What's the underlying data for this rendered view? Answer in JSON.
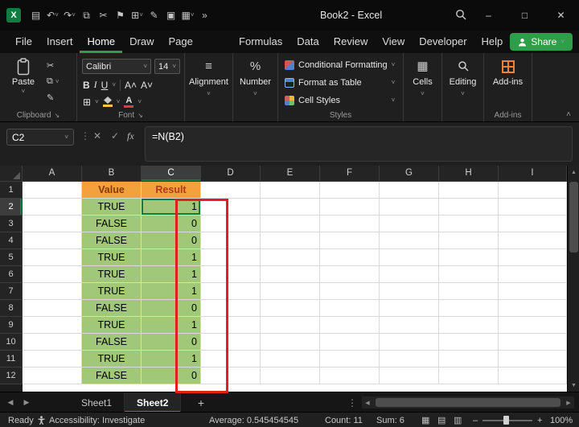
{
  "colors": {
    "accent_green": "#107C41",
    "ui_green": "#2E9E49",
    "header_orange": "#F2A13C",
    "value_text": "#8A3A00",
    "result_text": "#B03A1E",
    "cell_green": "#A0C878",
    "annotation_red": "#E0201C",
    "addins_orange": "#E8833A",
    "font_color_red": "#E03C31",
    "fill_yellow": "#FFC83D"
  },
  "titlebar": {
    "title": "Book2 - Excel",
    "logo_text": "X",
    "icons": [
      {
        "name": "save-icon",
        "glyph": "▤",
        "caret": false
      },
      {
        "name": "undo-icon",
        "glyph": "↶",
        "caret": true
      },
      {
        "name": "redo-icon",
        "glyph": "↷",
        "caret": true
      },
      {
        "name": "copy-pages-icon",
        "glyph": "⧉",
        "caret": false
      },
      {
        "name": "cut-icon",
        "glyph": "✂",
        "caret": false
      },
      {
        "name": "flag-icon",
        "glyph": "⚑",
        "caret": false
      },
      {
        "name": "calculator-icon",
        "glyph": "⊞",
        "caret": true
      },
      {
        "name": "format-painter-icon",
        "glyph": "✎",
        "caret": false
      },
      {
        "name": "camera-icon",
        "glyph": "▣",
        "caret": false
      },
      {
        "name": "table-icon",
        "glyph": "▦",
        "caret": true
      },
      {
        "name": "overflow-icon",
        "glyph": "»",
        "caret": false
      }
    ]
  },
  "window_controls": {
    "minimize": "–",
    "maximize": "□",
    "close": "✕"
  },
  "menu": {
    "items": [
      "File",
      "Insert",
      "Home",
      "Draw",
      "Page Layout",
      "Formulas",
      "Data",
      "Review",
      "View",
      "Developer",
      "Help"
    ],
    "active": "Home",
    "share_label": "Share"
  },
  "ribbon": {
    "clipboard": {
      "paste_label": "Paste",
      "label": "Clipboard"
    },
    "font": {
      "name": "Calibri",
      "size": "14",
      "label": "Font"
    },
    "alignment": {
      "label": "Alignment"
    },
    "number": {
      "label": "Number"
    },
    "styles": {
      "label": "Styles",
      "items": [
        "Conditional Formatting",
        "Format as Table",
        "Cell Styles"
      ]
    },
    "cells": {
      "label": "Cells"
    },
    "editing": {
      "label": "Editing"
    },
    "addins": {
      "button_label": "Add-ins",
      "label": "Add-ins"
    }
  },
  "formula_bar": {
    "name_box": "C2",
    "formula": "=N(B2)"
  },
  "grid": {
    "columns": [
      "A",
      "B",
      "C",
      "D",
      "E",
      "F",
      "G",
      "H",
      "I"
    ],
    "selected_column": "C",
    "selected_row": 2,
    "rows": [
      {
        "n": 1,
        "b": "Value",
        "c": "Result",
        "type": "header"
      },
      {
        "n": 2,
        "b": "TRUE",
        "c": "1",
        "type": "data"
      },
      {
        "n": 3,
        "b": "FALSE",
        "c": "0",
        "type": "data"
      },
      {
        "n": 4,
        "b": "FALSE",
        "c": "0",
        "type": "data"
      },
      {
        "n": 5,
        "b": "TRUE",
        "c": "1",
        "type": "data"
      },
      {
        "n": 6,
        "b": "TRUE",
        "c": "1",
        "type": "data"
      },
      {
        "n": 7,
        "b": "TRUE",
        "c": "1",
        "type": "data"
      },
      {
        "n": 8,
        "b": "FALSE",
        "c": "0",
        "type": "data"
      },
      {
        "n": 9,
        "b": "TRUE",
        "c": "1",
        "type": "data"
      },
      {
        "n": 10,
        "b": "FALSE",
        "c": "0",
        "type": "data"
      },
      {
        "n": 11,
        "b": "TRUE",
        "c": "1",
        "type": "data"
      },
      {
        "n": 12,
        "b": "FALSE",
        "c": "0",
        "type": "data"
      }
    ]
  },
  "sheets": {
    "tabs": [
      "Sheet1",
      "Sheet2"
    ],
    "active": "Sheet2",
    "add_label": "+"
  },
  "status_bar": {
    "ready": "Ready",
    "accessibility": "Accessibility: Investigate",
    "average": "Average: 0.545454545",
    "count": "Count: 11",
    "sum": "Sum: 6",
    "zoom": "100%"
  },
  "icons": {
    "cut": "✂",
    "copy": "⧉",
    "format_painter": "✎",
    "borders": "⊞",
    "caret": "˅",
    "collapse": "˄",
    "dialog_launcher": "↘",
    "ellipsis_v": "⋮",
    "cancel": "✕",
    "enter": "✓",
    "fx": "fx",
    "alignment": "≡",
    "percent": "%",
    "cells": "▦",
    "overflow": "»",
    "bold": "B",
    "italic": "I",
    "underline": "U",
    "grow_font": "A˄",
    "shrink_font": "A˅",
    "font_color": "A",
    "left_arrow": "◀",
    "right_arrow": "▶",
    "up_arrow": "▲",
    "down_arrow": "▼",
    "view_normal": "▦",
    "view_layout": "▤",
    "view_break": "▥"
  }
}
